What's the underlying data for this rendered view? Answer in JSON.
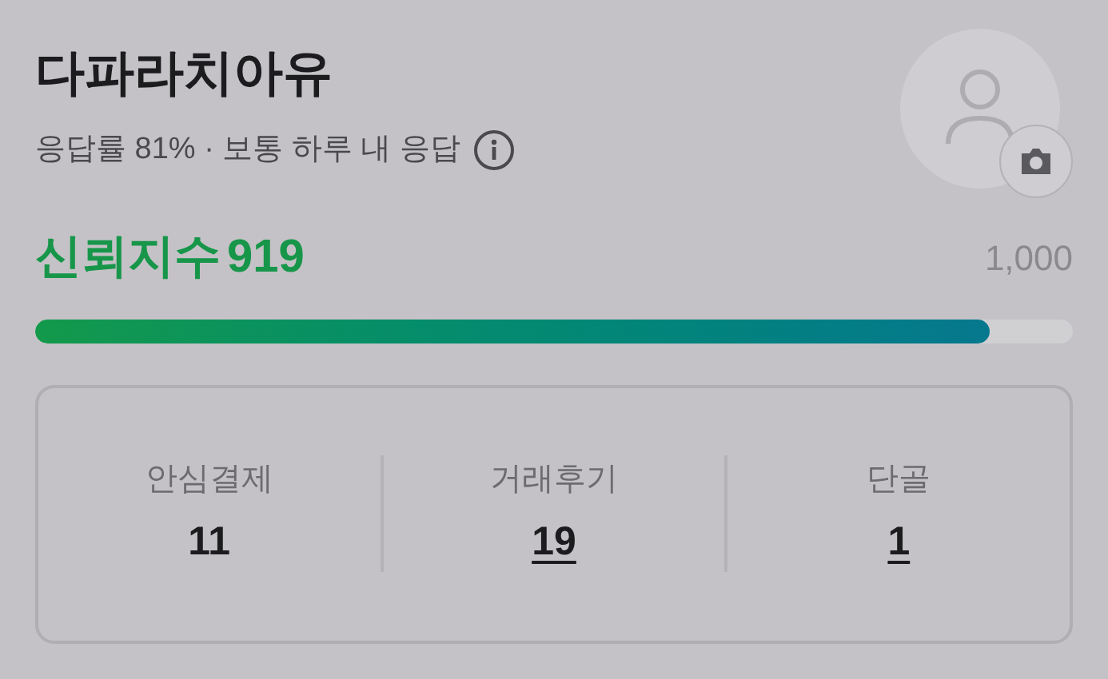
{
  "profile": {
    "name": "다파라치아유",
    "response_info": "응답률 81% · 보통 하루 내 응답"
  },
  "trust": {
    "label": "신뢰지수",
    "score": "919",
    "max": "1,000",
    "level": 0.92
  },
  "stats": [
    {
      "label": "안심결제",
      "value": "11",
      "link": false
    },
    {
      "label": "거래후기",
      "value": "19",
      "link": true
    },
    {
      "label": "단골",
      "value": "1",
      "link": true
    }
  ]
}
